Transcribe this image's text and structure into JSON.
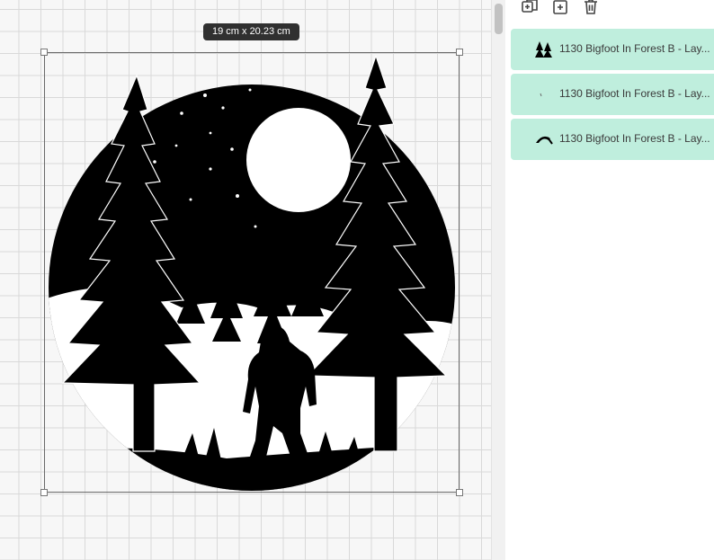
{
  "canvas": {
    "dimensions_label": "19  cm x 20.23  cm",
    "grid_color": "#d9d9d9",
    "artwork_name": "1130 Bigfoot In Forest B"
  },
  "toolbar": {
    "icons": [
      "duplicate-icon",
      "group-icon",
      "delete-icon"
    ]
  },
  "layers": [
    {
      "label": "1130 Bigfoot In Forest B - Lay...",
      "thumb": "tree-thumbnail"
    },
    {
      "label": "1130 Bigfoot In Forest B - Lay...",
      "thumb": "small-mark-thumbnail"
    },
    {
      "label": "1130 Bigfoot In Forest B - Lay...",
      "thumb": "arc-thumbnail"
    }
  ],
  "colors": {
    "layer_bg": "#bfeedd",
    "badge_bg": "#303030",
    "artwork": "#000000"
  }
}
